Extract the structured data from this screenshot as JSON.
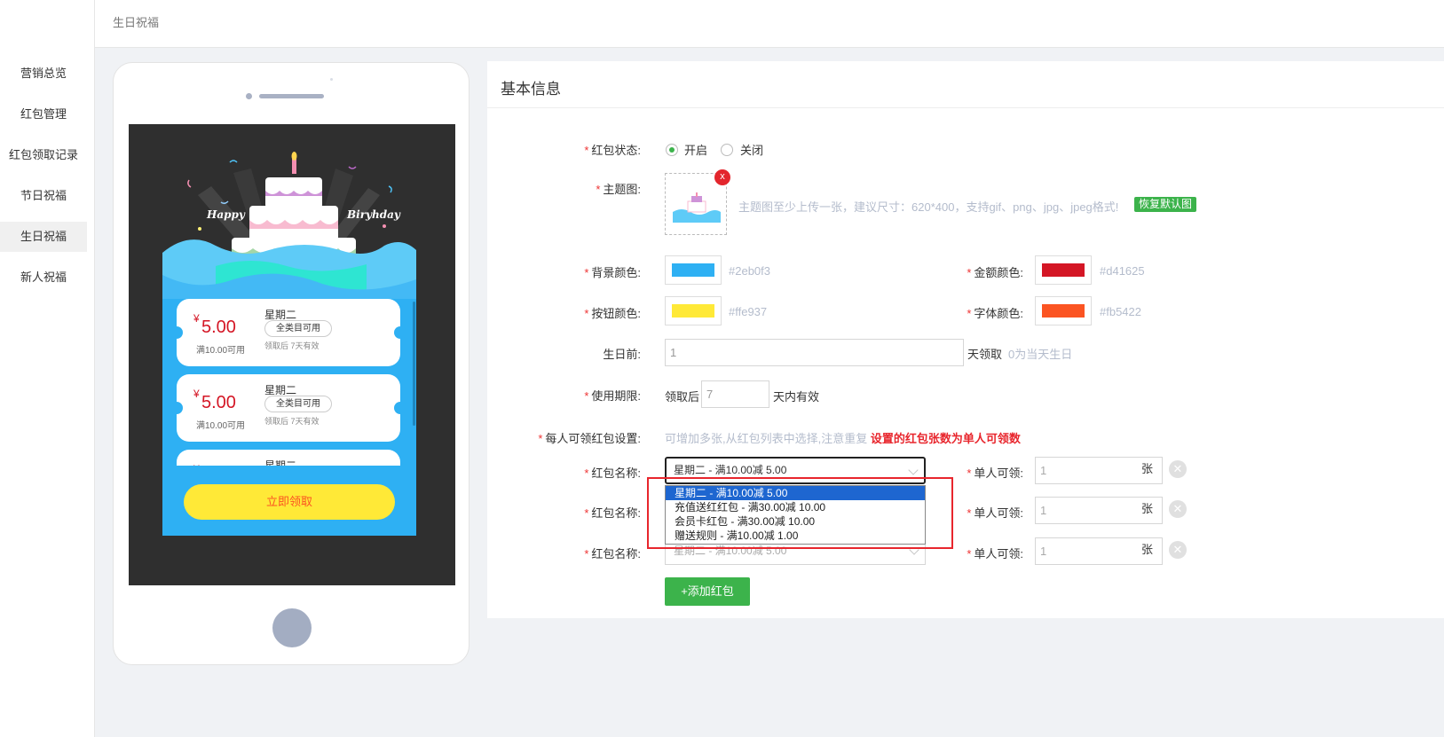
{
  "breadcrumb": "生日祝福",
  "sidebar": {
    "items": [
      {
        "label": "营销总览"
      },
      {
        "label": "红包管理"
      },
      {
        "label": "红包领取记录"
      },
      {
        "label": "节日祝福"
      },
      {
        "label": "生日祝福",
        "active": true
      },
      {
        "label": "新人祝福"
      }
    ]
  },
  "preview": {
    "banner_left": "Happy",
    "banner_right": "Biryhday",
    "currency": "¥",
    "coupons": [
      {
        "amount": "5.00",
        "condition": "满10.00可用",
        "day": "星期二",
        "scope": "全类目可用",
        "validity": "领取后 7天有效"
      },
      {
        "amount": "5.00",
        "condition": "满10.00可用",
        "day": "星期二",
        "scope": "全类目可用",
        "validity": "领取后 7天有效"
      },
      {
        "amount": "",
        "condition": "",
        "day": "星期二",
        "scope": "",
        "validity": ""
      }
    ],
    "claim_button": "立即领取"
  },
  "form": {
    "section_title": "基本信息",
    "status": {
      "label": "红包状态:",
      "on": "开启",
      "off": "关闭",
      "value": "开启"
    },
    "theme": {
      "label": "主题图:",
      "delete": "x",
      "hint": "主题图至少上传一张，建议尺寸：620*400，支持gif、png、jpg、jpeg格式!",
      "restore": "恢复默认图"
    },
    "bg_color": {
      "label": "背景颜色:",
      "value": "#2eb0f3"
    },
    "amount_color": {
      "label": "金额颜色:",
      "value": "#d41625"
    },
    "button_color": {
      "label": "按钮颜色:",
      "value": "#ffe937"
    },
    "font_color": {
      "label": "字体颜色:",
      "value": "#fb5422"
    },
    "birthday_before": {
      "label": "生日前:",
      "value": "1",
      "suffix": "天领取",
      "hint": "0为当天生日"
    },
    "validity": {
      "label": "使用期限:",
      "prefix": "领取后",
      "value": "7",
      "suffix": "天内有效"
    },
    "per_person": {
      "label": "每人可领红包设置:",
      "hint": "可增加多张,从红包列表中选择,注意重复",
      "warning": "设置的红包张数为单人可领数"
    },
    "rows": [
      {
        "name_label": "红包名称:",
        "selected": "星期二 - 满10.00减 5.00",
        "qty_label": "单人可领:",
        "qty": "1",
        "unit": "张"
      },
      {
        "name_label": "红包名称:",
        "selected": "",
        "qty_label": "单人可领:",
        "qty": "1",
        "unit": "张"
      },
      {
        "name_label": "红包名称:",
        "selected": "星期二 - 满10.00减 5.00",
        "qty_label": "单人可领:",
        "qty": "1",
        "unit": "张"
      }
    ],
    "dropdown_options": [
      "星期二 - 满10.00减 5.00",
      "充值送红红包 - 满30.00减 10.00",
      "会员卡红包 - 满30.00减 10.00",
      "赠送规则 - 满10.00减 1.00"
    ],
    "remove_icon": "✕",
    "add_button": "+添加红包"
  },
  "colors": {
    "accent_green": "#3cb34b",
    "danger_red": "#e8262d",
    "highlight_blue": "#1e66d0"
  }
}
